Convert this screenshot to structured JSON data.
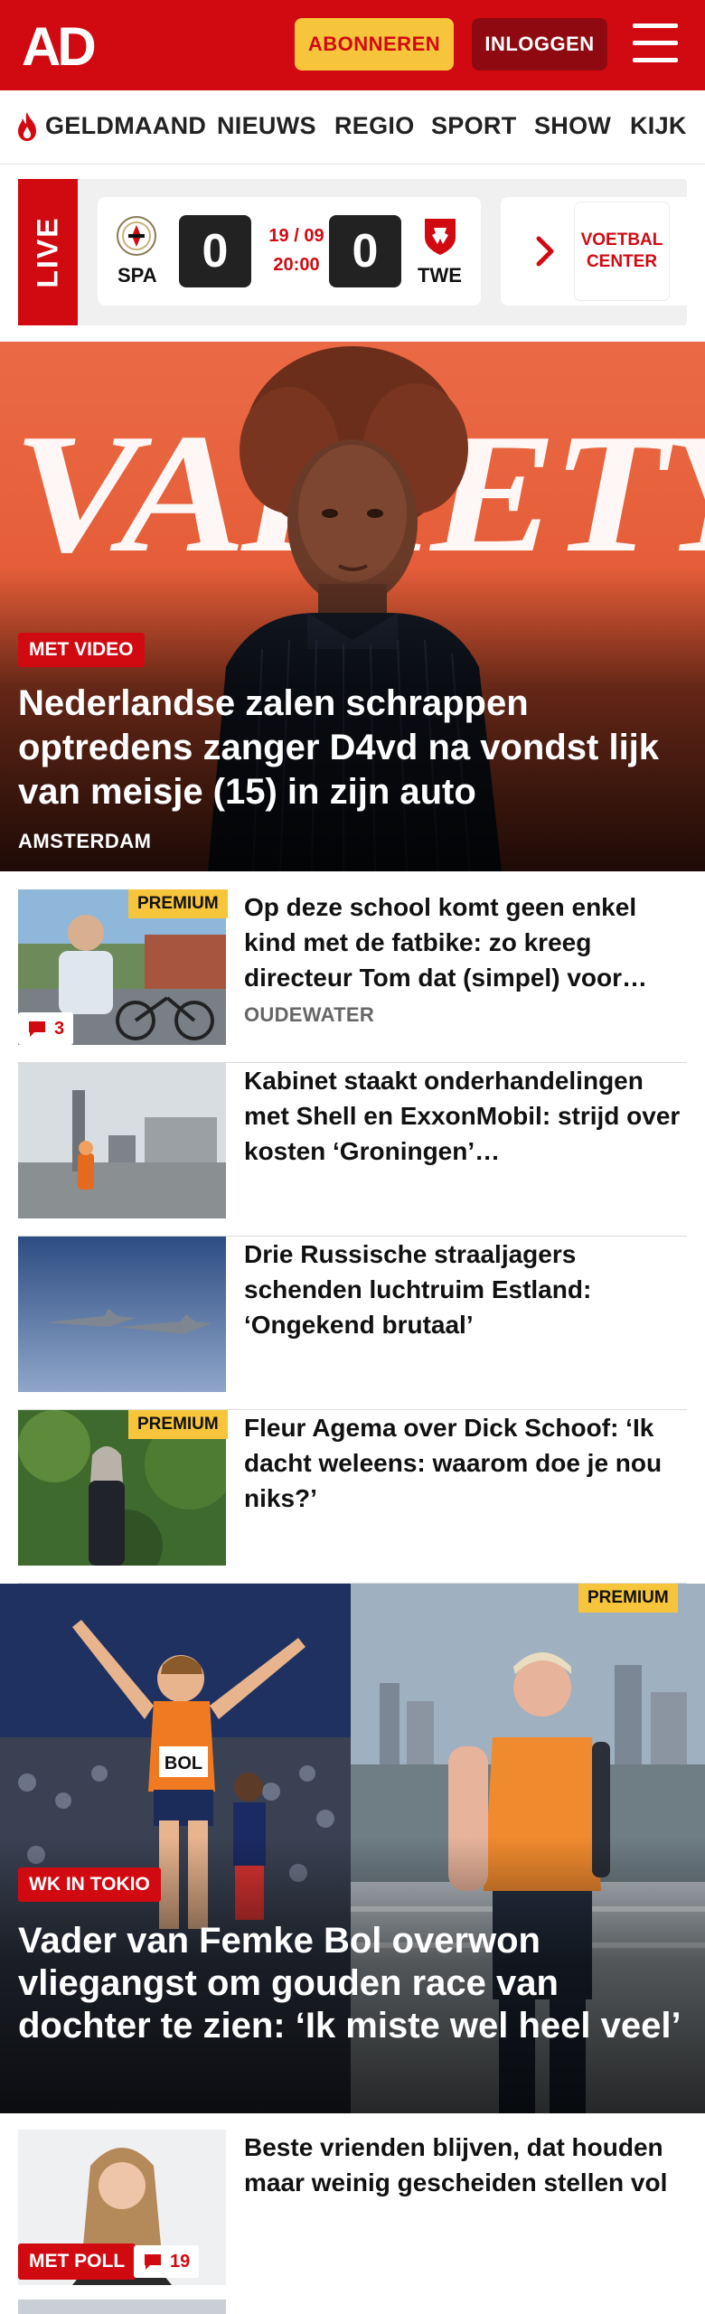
{
  "header": {
    "logo_text": "AD",
    "subscribe_label": "ABONNEREN",
    "login_label": "INLOGGEN",
    "menu_icon": "hamburger-menu-icon",
    "brand_color": "#d10a11",
    "accent_color": "#f6c53b"
  },
  "nav": {
    "items": [
      {
        "label": "GELDMAAND",
        "icon": "flame-icon"
      },
      {
        "label": "NIEUWS"
      },
      {
        "label": "REGIO"
      },
      {
        "label": "SPORT"
      },
      {
        "label": "SHOW"
      },
      {
        "label": "KIJK"
      }
    ]
  },
  "live": {
    "tag": "LIVE",
    "match": {
      "home_team": "SPA",
      "away_team": "TWE",
      "home_score": "0",
      "away_score": "0",
      "date": "19 / 09",
      "time": "20:00"
    },
    "next_icon": "chevron-right-icon",
    "voetbal_center_label": "VOETBAL\nCENTER"
  },
  "hero": {
    "badge": "MET VIDEO",
    "title": "Nederlandse zalen schrappen optredens zanger D4vd na vondst lijk van meisje (15) in zijn auto",
    "location": "AMSTERDAM",
    "background_text": "VARIETY"
  },
  "articles": [
    {
      "title": "Op deze school komt geen enkel kind met de fatbike: zo kreeg directeur Tom dat (simpel) voor…",
      "location": "OUDEWATER",
      "premium": "PREMIUM",
      "comments": "3"
    },
    {
      "title": "Kabinet staakt onderhandelin­gen met Shell en ExxonMobil: strijd over kosten ‘Groningen’…"
    },
    {
      "title": "Drie Russische straaljagers schenden luchtruim Estland: ‘Ongekend brutaal’"
    },
    {
      "title": "Fleur Agema over Dick Schoof: ‘Ik dacht weleens: waarom doe je nou niks?’",
      "premium": "PREMIUM"
    }
  ],
  "feature": {
    "badge": "WK IN TOKIO",
    "premium": "PREMIUM",
    "title": "Vader van Femke Bol overwon vliegangst om gouden race van dochter te zien: ‘Ik miste wel heel veel’",
    "bib_text": "BOL"
  },
  "last_article": {
    "title": "Beste vrienden blijven, dat houden maar weinig gescheiden stellen vol",
    "badge": "MET POLL",
    "comments": "19"
  }
}
